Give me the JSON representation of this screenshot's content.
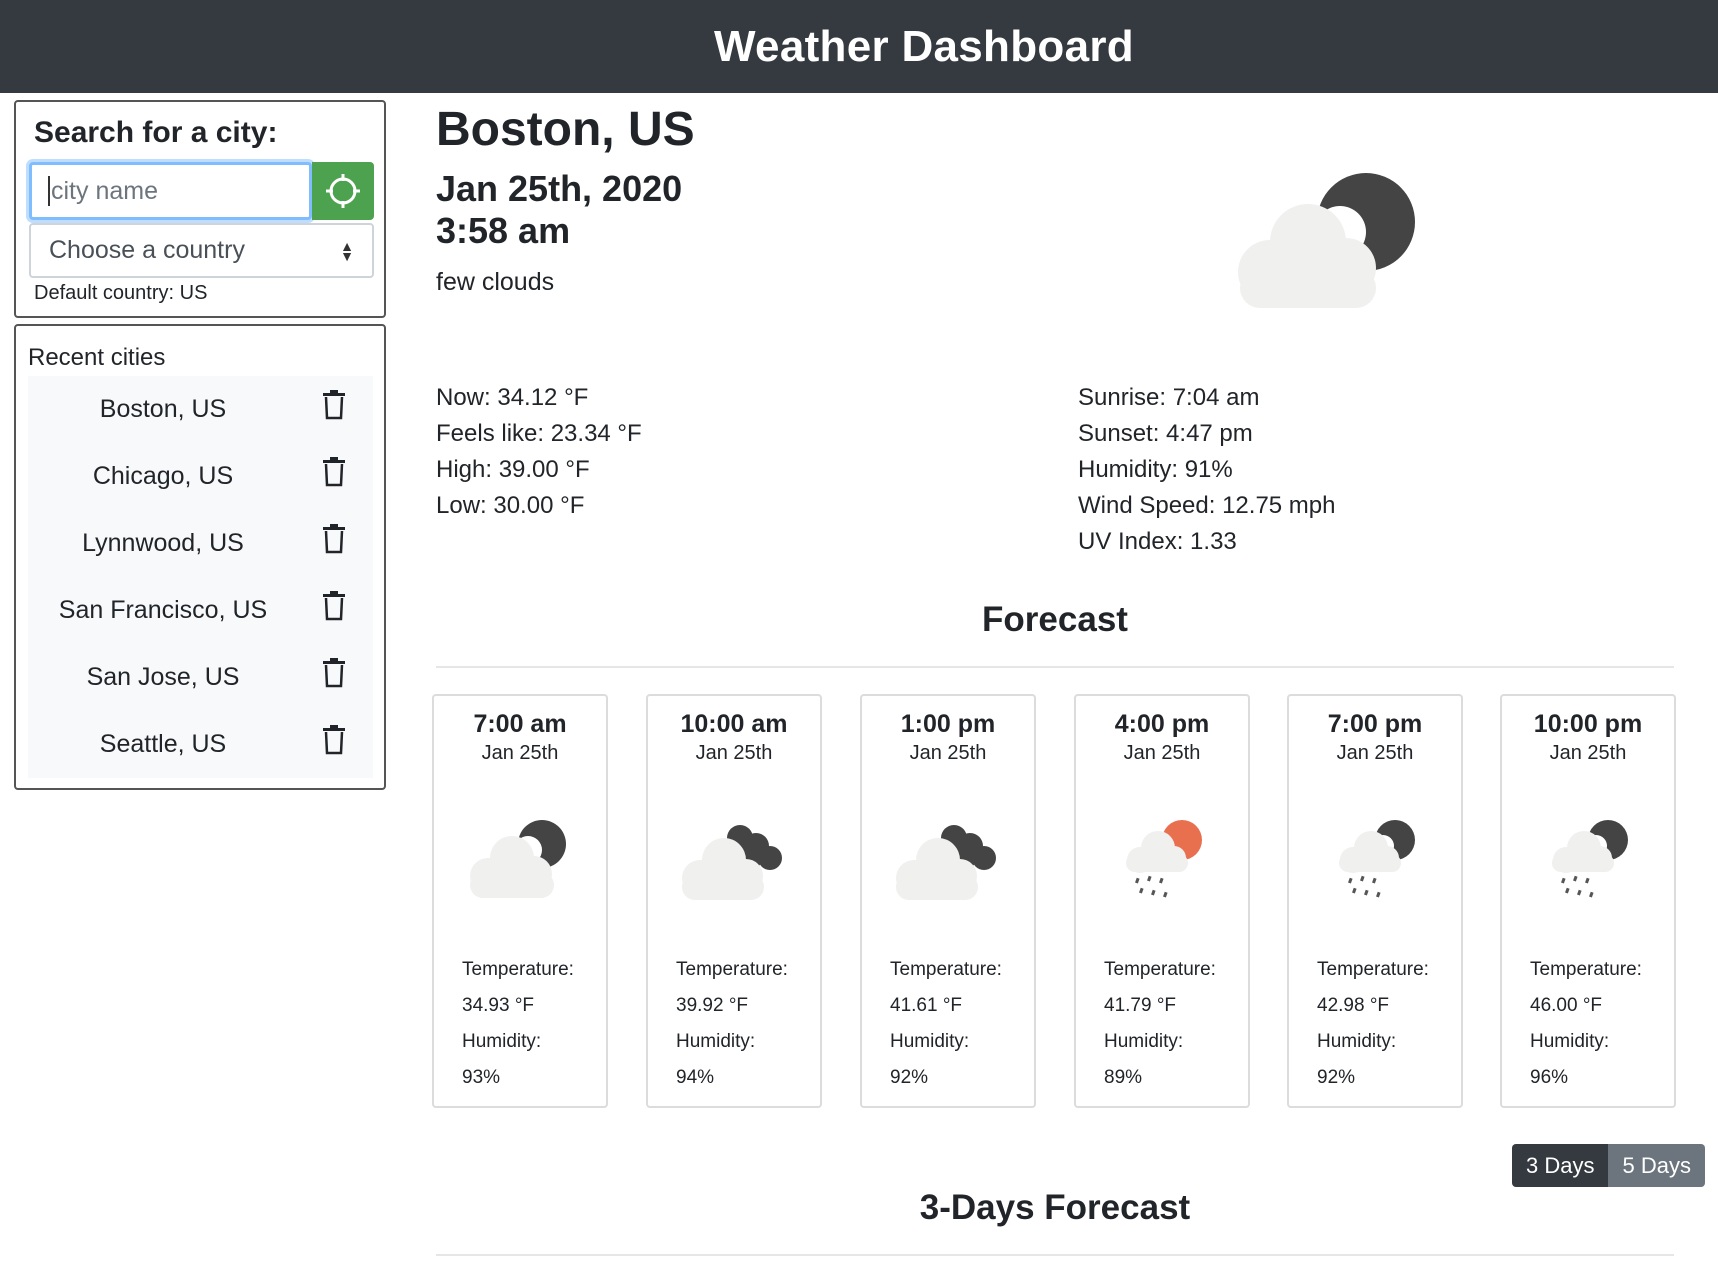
{
  "header": {
    "title": "Weather Dashboard"
  },
  "search": {
    "label": "Search for a city:",
    "placeholder": "city name",
    "value": "",
    "country_select": "Choose a country",
    "default_note": "Default country: US"
  },
  "recent": {
    "title": "Recent cities",
    "items": [
      {
        "label": "Boston, US"
      },
      {
        "label": "Chicago, US"
      },
      {
        "label": "Lynnwood, US"
      },
      {
        "label": "San Francisco, US"
      },
      {
        "label": "San Jose, US"
      },
      {
        "label": "Seattle, US"
      }
    ]
  },
  "current": {
    "city": "Boston, US",
    "date": "Jan 25th, 2020",
    "time": "3:58 am",
    "description": "few clouds",
    "icon": "cloud-night-icon",
    "left_stats": [
      "Now: 34.12 °F",
      "Feels like: 23.34 °F",
      "High: 39.00 °F",
      "Low: 30.00 °F"
    ],
    "right_stats": [
      "Sunrise: 7:04 am",
      "Sunset: 4:47 pm",
      "Humidity: 91%",
      "Wind Speed: 12.75 mph",
      "UV Index: 1.33"
    ]
  },
  "forecast": {
    "title": "Forecast",
    "temp_label": "Temperature:",
    "humidity_label": "Humidity:",
    "items": [
      {
        "time": "7:00 am",
        "date": "Jan 25th",
        "icon": "cloud-night-icon",
        "temp": "34.93 °F",
        "humidity": "93%"
      },
      {
        "time": "10:00 am",
        "date": "Jan 25th",
        "icon": "broken-clouds-icon",
        "temp": "39.92 °F",
        "humidity": "94%"
      },
      {
        "time": "1:00 pm",
        "date": "Jan 25th",
        "icon": "broken-clouds-icon",
        "temp": "41.61 °F",
        "humidity": "92%"
      },
      {
        "time": "4:00 pm",
        "date": "Jan 25th",
        "icon": "rain-sun-icon",
        "temp": "41.79 °F",
        "humidity": "89%"
      },
      {
        "time": "7:00 pm",
        "date": "Jan 25th",
        "icon": "rain-night-icon",
        "temp": "42.98 °F",
        "humidity": "92%"
      },
      {
        "time": "10:00 pm",
        "date": "Jan 25th",
        "icon": "rain-night-icon",
        "temp": "46.00 °F",
        "humidity": "96%"
      }
    ]
  },
  "toggle": {
    "three_days": "3 Days",
    "five_days": "5 Days",
    "active": "3 Days"
  },
  "days_forecast": {
    "title": "3-Days Forecast"
  },
  "colors": {
    "header_bg": "#343a40",
    "locate_btn": "#4ca24e",
    "toggle_active": "#343a40",
    "toggle_inactive": "#6c757d",
    "sun": "#e8704f",
    "moon": "#444444",
    "cloud": "#f0f0ef"
  }
}
